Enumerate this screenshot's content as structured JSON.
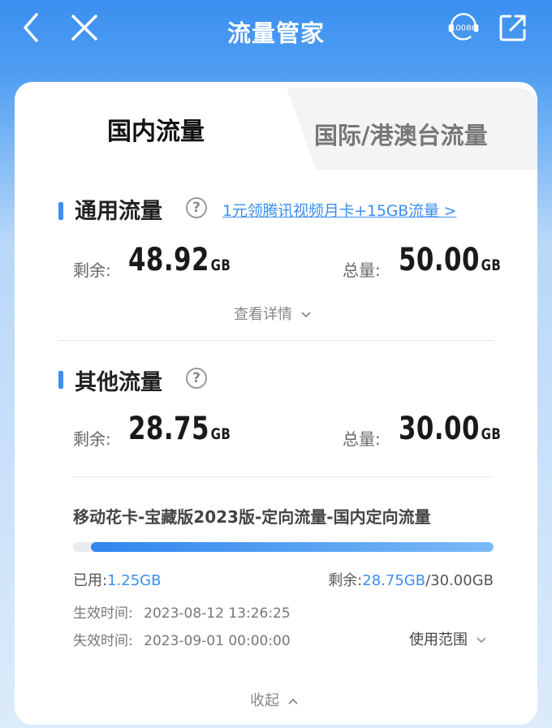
{
  "header": {
    "title": "流量管家",
    "service_badge": "10086"
  },
  "tabs": [
    {
      "label": "国内流量",
      "active": true
    },
    {
      "label": "国际/港澳台流量",
      "active": false
    }
  ],
  "general": {
    "title": "通用流量",
    "help": "?",
    "promo": "1元领腾讯视频月卡+15GB流量 >",
    "remaining_label": "剩余:",
    "remaining_value": "48.92",
    "remaining_unit": "GB",
    "total_label": "总量:",
    "total_value": "50.00",
    "total_unit": "GB",
    "details": "查看详情"
  },
  "other": {
    "title": "其他流量",
    "help": "?",
    "remaining_label": "剩余:",
    "remaining_value": "28.75",
    "remaining_unit": "GB",
    "total_label": "总量:",
    "total_value": "30.00",
    "total_unit": "GB"
  },
  "package": {
    "name": "移动花卡-宝藏版2023版-定向流量-国内定向流量",
    "remaining_fraction": 0.958,
    "used_label": "已用:",
    "used_value": "1.25GB",
    "remain_label": "剩余:",
    "remain_value": "28.75GB",
    "remain_total": "/30.00GB",
    "effective_label": "生效时间:",
    "effective_value": "2023-08-12 13:26:25",
    "expire_label": "失效时间:",
    "expire_value": "2023-09-01 00:00:00",
    "scope": "使用范围",
    "collapse": "收起"
  },
  "colors": {
    "accent": "#3d8ef0",
    "header": "#3b8ff0"
  }
}
